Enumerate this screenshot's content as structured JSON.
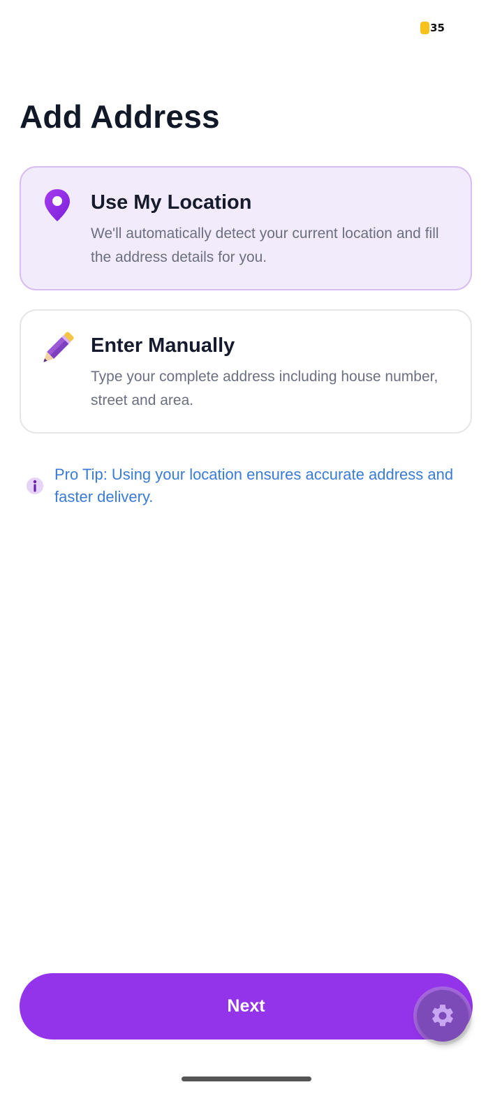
{
  "status_bar": {
    "battery": "35"
  },
  "page": {
    "title": "Add Address"
  },
  "options": [
    {
      "title": "Use My Location",
      "description": "We'll automatically detect your current location and fill the address details for you.",
      "icon": "location-pin-icon",
      "selected": true
    },
    {
      "title": "Enter Manually",
      "description": "Type your complete address including house number, street and area.",
      "icon": "pencil-icon",
      "selected": false
    }
  ],
  "tip": {
    "text": "Pro Tip: Using your location ensures accurate address and faster delivery.",
    "icon": "info-icon"
  },
  "footer": {
    "next_label": "Next"
  },
  "fab": {
    "icon": "gear-icon"
  },
  "colors": {
    "accent": "#9333ea",
    "selected_card_bg": "#f2ebfb",
    "selected_card_border": "#d6bdf2",
    "tip_text": "#3a7bd5",
    "title_text": "#111827"
  }
}
